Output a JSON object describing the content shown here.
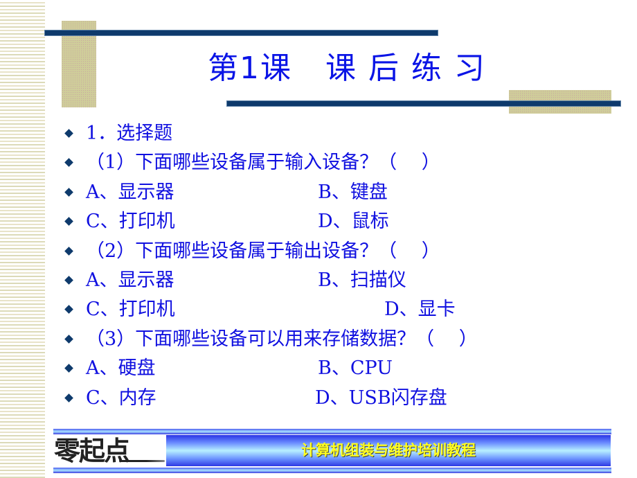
{
  "slide": {
    "title": "第1课   课 后 练 习",
    "accent_colors": {
      "text": "#1010E0",
      "navy": "#0E3A6C",
      "tan": "#CFCD9A",
      "footer_text": "#FFFF20"
    }
  },
  "content": {
    "rows": [
      {
        "text": "1．选择题"
      },
      {
        "text": "（1）下面哪些设备属于输入设备？（　 ）"
      },
      {
        "text": "A、显示器",
        "col2": "B、键盘"
      },
      {
        "text": "C、打印机",
        "col2": "D、鼠标"
      },
      {
        "text": "（2）下面哪些设备属于输出设备？（　 ）"
      },
      {
        "text": "A、显示器",
        "col2": "B、扫描仪"
      },
      {
        "text": "C、打印机",
        "col2": "D、显卡"
      },
      {
        "text": "（3）下面哪些设备可以用来存储数据？（　 ）"
      },
      {
        "text": "A、硬盘",
        "col2": "B、CPU"
      },
      {
        "text": "C、内存",
        "col2": "D、USB闪存盘"
      }
    ]
  },
  "footer": {
    "logo_text": "零起点",
    "course_title": "计算机组装与维护培训教程"
  }
}
